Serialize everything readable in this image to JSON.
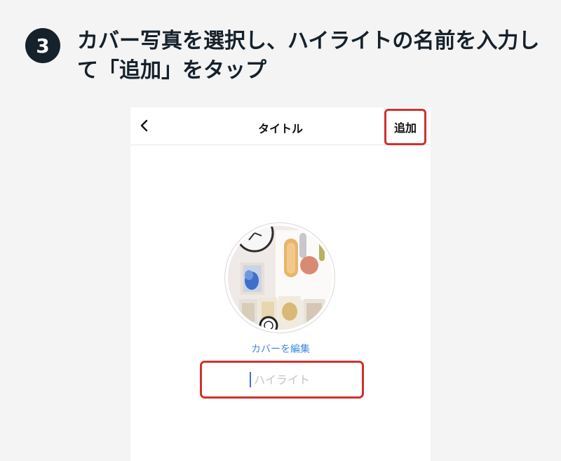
{
  "step": {
    "number": "3",
    "instruction": "カバー写真を選択し、ハイライトの名前を入力して「追加」をタップ"
  },
  "navbar": {
    "back_icon": "chevron-left-icon",
    "title": "タイトル",
    "add_label": "追加"
  },
  "cover": {
    "image": "collage-cover-photo",
    "edit_label": "カバーを編集"
  },
  "highlight_name": {
    "value": "",
    "placeholder": "ハイライト"
  },
  "colors": {
    "badge": "#15212b",
    "emphasis_frame": "#d0312d",
    "link": "#3f8ae0",
    "placeholder": "#c4c4c4",
    "page_background": "#f4f4f4"
  }
}
